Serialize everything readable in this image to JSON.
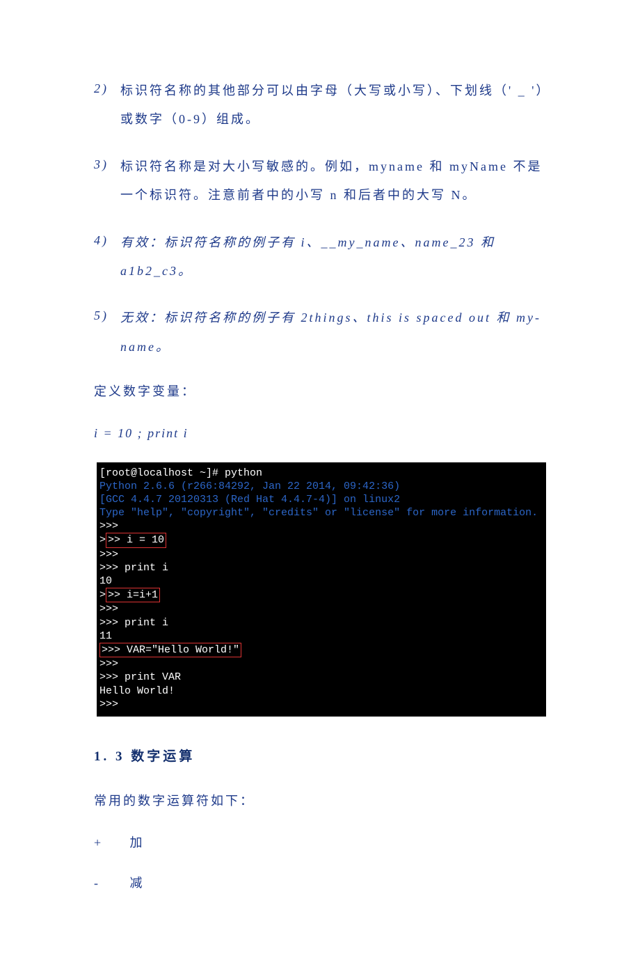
{
  "items": [
    {
      "num": "2)",
      "text": "标识符名称的其他部分可以由字母（大写或小写）、下划线（' _ '）或数字（0-9）组成。"
    },
    {
      "num": "3)",
      "text": "标识符名称是对大小写敏感的。例如，myname 和 myName 不是一个标识符。注意前者中的小写 n 和后者中的大写 N。"
    },
    {
      "num": "4)",
      "text": "有效：标识符名称的例子有 i、__my_name、name_23 和 a1b2_c3。"
    },
    {
      "num": "5)",
      "text": "无效：标识符名称的例子有 2things、this is spaced out 和 my-name。"
    }
  ],
  "define_label": "定义数字变量：",
  "code_inline": "i = 10  ; print  i",
  "terminal": {
    "l1": "[root@localhost ~]# python",
    "l2": "Python 2.6.6 (r266:84292, Jan 22 2014, 09:42:36)",
    "l3": "[GCC 4.4.7 20120313 (Red Hat 4.4.7-4)] on linux2",
    "l4": "Type \"help\", \"copyright\", \"credits\" or \"license\" for more information.",
    "p": ">>>",
    "assign1": ">> i = 10",
    "print1": ">>> print i",
    "out1": "10",
    "assign2": ">> i=i+1",
    "print2": ">>> print i",
    "out2": "11",
    "assign3": ">>> VAR=\"Hello World!\"",
    "print3": ">>> print VAR",
    "out3": "Hello World!"
  },
  "heading": "1. 3  数字运算",
  "ops_label": "常用的数字运算符如下：",
  "ops": [
    {
      "sym": "+",
      "name": "加"
    },
    {
      "sym": "-",
      "name": "减"
    }
  ]
}
